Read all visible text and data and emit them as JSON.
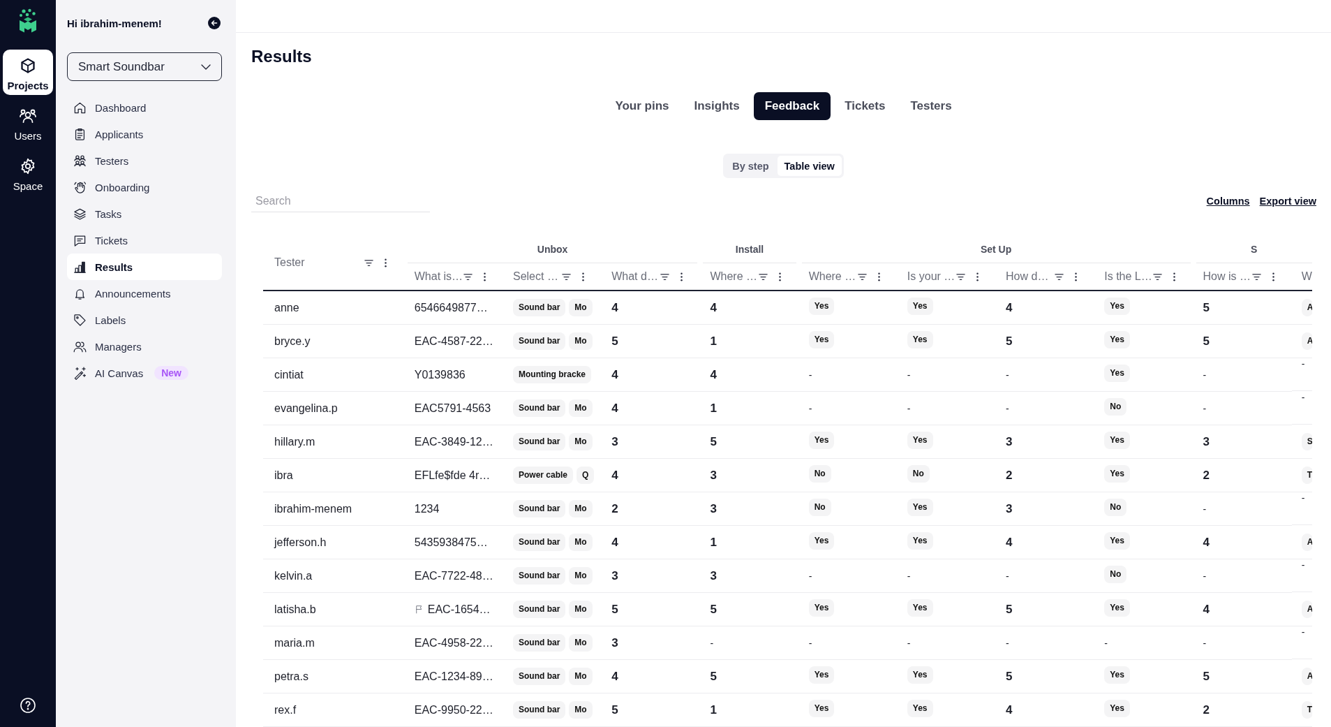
{
  "rail": {
    "items": [
      {
        "label": "Projects",
        "selected": true
      },
      {
        "label": "Users",
        "selected": false
      },
      {
        "label": "Space",
        "selected": false
      }
    ]
  },
  "sidebar": {
    "greeting": "Hi ibrahim-menem!",
    "project": "Smart Soundbar",
    "items": [
      {
        "label": "Dashboard",
        "selected": false
      },
      {
        "label": "Applicants",
        "selected": false
      },
      {
        "label": "Testers",
        "selected": false
      },
      {
        "label": "Onboarding",
        "selected": false
      },
      {
        "label": "Tasks",
        "selected": false
      },
      {
        "label": "Tickets",
        "selected": false
      },
      {
        "label": "Results",
        "selected": true
      },
      {
        "label": "Announcements",
        "selected": false
      },
      {
        "label": "Labels",
        "selected": false
      },
      {
        "label": "Managers",
        "selected": false
      },
      {
        "label": "AI Canvas",
        "selected": false,
        "badge": "New"
      }
    ]
  },
  "page": {
    "title": "Results"
  },
  "tabs": [
    {
      "label": "Your pins",
      "selected": false
    },
    {
      "label": "Insights",
      "selected": false
    },
    {
      "label": "Feedback",
      "selected": true
    },
    {
      "label": "Tickets",
      "selected": false
    },
    {
      "label": "Testers",
      "selected": false
    }
  ],
  "view_toggle": [
    {
      "label": "By step",
      "selected": false
    },
    {
      "label": "Table view",
      "selected": true
    }
  ],
  "search": {
    "placeholder": "Search"
  },
  "actions": [
    "Columns",
    "Export view"
  ],
  "table": {
    "tester_header": "Tester",
    "groups": [
      {
        "label": "Unbox",
        "columns": [
          "What is…",
          "Select …",
          "What d…"
        ]
      },
      {
        "label": "Install",
        "columns": [
          "Where …"
        ]
      },
      {
        "label": "Set Up",
        "columns": [
          "Where …",
          "Is your …",
          "How d…",
          "Is the L…"
        ]
      },
      {
        "label": "S",
        "columns": [
          "How is …",
          "W"
        ]
      }
    ],
    "rows": [
      {
        "tester": "anne",
        "flagged": false,
        "cells": [
          {
            "kind": "text",
            "text": "6546649877…"
          },
          {
            "kind": "tags",
            "tags": [
              "Sound bar",
              "Mo"
            ]
          },
          {
            "kind": "score",
            "text": "4"
          },
          {
            "kind": "score",
            "text": "4"
          },
          {
            "kind": "tag",
            "text": "Yes"
          },
          {
            "kind": "tag",
            "text": "Yes"
          },
          {
            "kind": "score",
            "text": "4"
          },
          {
            "kind": "tag",
            "text": "Yes"
          },
          {
            "kind": "score",
            "text": "5"
          },
          {
            "kind": "tag",
            "text": "A"
          }
        ]
      },
      {
        "tester": "bryce.y",
        "flagged": false,
        "cells": [
          {
            "kind": "text",
            "text": "EAC-4587-22…"
          },
          {
            "kind": "tags",
            "tags": [
              "Sound bar",
              "Mo"
            ]
          },
          {
            "kind": "score",
            "text": "5"
          },
          {
            "kind": "score",
            "text": "1"
          },
          {
            "kind": "tag",
            "text": "Yes"
          },
          {
            "kind": "tag",
            "text": "Yes"
          },
          {
            "kind": "score",
            "text": "5"
          },
          {
            "kind": "tag",
            "text": "Yes"
          },
          {
            "kind": "score",
            "text": "5"
          },
          {
            "kind": "tag",
            "text": "A"
          }
        ]
      },
      {
        "tester": "cintiat",
        "flagged": false,
        "cells": [
          {
            "kind": "text",
            "text": "Y0139836"
          },
          {
            "kind": "tags",
            "tags": [
              "Mounting bracke"
            ]
          },
          {
            "kind": "score",
            "text": "4"
          },
          {
            "kind": "score",
            "text": "4"
          },
          {
            "kind": "text",
            "text": "-"
          },
          {
            "kind": "text",
            "text": "-"
          },
          {
            "kind": "text",
            "text": "-"
          },
          {
            "kind": "tag",
            "text": "Yes"
          },
          {
            "kind": "text",
            "text": "-"
          },
          {
            "kind": "text",
            "text": "-"
          }
        ]
      },
      {
        "tester": "evangelina.p",
        "flagged": false,
        "cells": [
          {
            "kind": "text",
            "text": "EAC5791-4563"
          },
          {
            "kind": "tags",
            "tags": [
              "Sound bar",
              "Mo"
            ]
          },
          {
            "kind": "score",
            "text": "4"
          },
          {
            "kind": "score",
            "text": "1"
          },
          {
            "kind": "text",
            "text": "-"
          },
          {
            "kind": "text",
            "text": "-"
          },
          {
            "kind": "text",
            "text": "-"
          },
          {
            "kind": "tag",
            "text": "No"
          },
          {
            "kind": "text",
            "text": "-"
          },
          {
            "kind": "text",
            "text": "-"
          }
        ]
      },
      {
        "tester": "hillary.m",
        "flagged": false,
        "cells": [
          {
            "kind": "text",
            "text": "EAC-3849-12…"
          },
          {
            "kind": "tags",
            "tags": [
              "Sound bar",
              "Mo"
            ]
          },
          {
            "kind": "score",
            "text": "3"
          },
          {
            "kind": "score",
            "text": "5"
          },
          {
            "kind": "tag",
            "text": "Yes"
          },
          {
            "kind": "tag",
            "text": "Yes"
          },
          {
            "kind": "score",
            "text": "3"
          },
          {
            "kind": "tag",
            "text": "Yes"
          },
          {
            "kind": "score",
            "text": "3"
          },
          {
            "kind": "tag",
            "text": "S"
          }
        ]
      },
      {
        "tester": "ibra",
        "flagged": false,
        "cells": [
          {
            "kind": "text",
            "text": "EFLfe$fde 4r…"
          },
          {
            "kind": "tags",
            "tags": [
              "Power cable",
              "Q"
            ]
          },
          {
            "kind": "score",
            "text": "4"
          },
          {
            "kind": "score",
            "text": "3"
          },
          {
            "kind": "tag",
            "text": "No"
          },
          {
            "kind": "tag",
            "text": "No"
          },
          {
            "kind": "score",
            "text": "2"
          },
          {
            "kind": "tag",
            "text": "Yes"
          },
          {
            "kind": "score",
            "text": "2"
          },
          {
            "kind": "tag",
            "text": "T"
          }
        ]
      },
      {
        "tester": "ibrahim-menem",
        "flagged": false,
        "cells": [
          {
            "kind": "text",
            "text": "1234"
          },
          {
            "kind": "tags",
            "tags": [
              "Sound bar",
              "Mo"
            ]
          },
          {
            "kind": "score",
            "text": "2"
          },
          {
            "kind": "score",
            "text": "3"
          },
          {
            "kind": "tag",
            "text": "No"
          },
          {
            "kind": "tag",
            "text": "Yes"
          },
          {
            "kind": "score",
            "text": "3"
          },
          {
            "kind": "tag",
            "text": "No"
          },
          {
            "kind": "text",
            "text": "-"
          },
          {
            "kind": "text",
            "text": "-"
          }
        ]
      },
      {
        "tester": "jefferson.h",
        "flagged": false,
        "cells": [
          {
            "kind": "text",
            "text": "5435938475…"
          },
          {
            "kind": "tags",
            "tags": [
              "Sound bar",
              "Mo"
            ]
          },
          {
            "kind": "score",
            "text": "4"
          },
          {
            "kind": "score",
            "text": "1"
          },
          {
            "kind": "tag",
            "text": "Yes"
          },
          {
            "kind": "tag",
            "text": "Yes"
          },
          {
            "kind": "score",
            "text": "4"
          },
          {
            "kind": "tag",
            "text": "Yes"
          },
          {
            "kind": "score",
            "text": "4"
          },
          {
            "kind": "tag",
            "text": "A"
          }
        ]
      },
      {
        "tester": "kelvin.a",
        "flagged": false,
        "cells": [
          {
            "kind": "text",
            "text": "EAC-7722-48…"
          },
          {
            "kind": "tags",
            "tags": [
              "Sound bar",
              "Mo"
            ]
          },
          {
            "kind": "score",
            "text": "3"
          },
          {
            "kind": "score",
            "text": "3"
          },
          {
            "kind": "text",
            "text": "-"
          },
          {
            "kind": "text",
            "text": "-"
          },
          {
            "kind": "text",
            "text": "-"
          },
          {
            "kind": "tag",
            "text": "No"
          },
          {
            "kind": "text",
            "text": "-"
          },
          {
            "kind": "text",
            "text": "-"
          }
        ]
      },
      {
        "tester": "latisha.b",
        "flagged": true,
        "cells": [
          {
            "kind": "text",
            "text": "EAC-1654…"
          },
          {
            "kind": "tags",
            "tags": [
              "Sound bar",
              "Mo"
            ]
          },
          {
            "kind": "score",
            "text": "5"
          },
          {
            "kind": "score",
            "text": "5"
          },
          {
            "kind": "tag",
            "text": "Yes"
          },
          {
            "kind": "tag",
            "text": "Yes"
          },
          {
            "kind": "score",
            "text": "5"
          },
          {
            "kind": "tag",
            "text": "Yes"
          },
          {
            "kind": "score",
            "text": "4"
          },
          {
            "kind": "tag",
            "text": "A"
          }
        ]
      },
      {
        "tester": "maria.m",
        "flagged": false,
        "cells": [
          {
            "kind": "text",
            "text": "EAC-4958-22…"
          },
          {
            "kind": "tags",
            "tags": [
              "Sound bar",
              "Mo"
            ]
          },
          {
            "kind": "score",
            "text": "3"
          },
          {
            "kind": "text",
            "text": "-"
          },
          {
            "kind": "text",
            "text": "-"
          },
          {
            "kind": "text",
            "text": "-"
          },
          {
            "kind": "text",
            "text": "-"
          },
          {
            "kind": "text",
            "text": "-"
          },
          {
            "kind": "text",
            "text": "-"
          },
          {
            "kind": "text",
            "text": "-"
          }
        ]
      },
      {
        "tester": "petra.s",
        "flagged": false,
        "cells": [
          {
            "kind": "text",
            "text": "EAC-1234-89…"
          },
          {
            "kind": "tags",
            "tags": [
              "Sound bar",
              "Mo"
            ]
          },
          {
            "kind": "score",
            "text": "4"
          },
          {
            "kind": "score",
            "text": "5"
          },
          {
            "kind": "tag",
            "text": "Yes"
          },
          {
            "kind": "tag",
            "text": "Yes"
          },
          {
            "kind": "score",
            "text": "5"
          },
          {
            "kind": "tag",
            "text": "Yes"
          },
          {
            "kind": "score",
            "text": "5"
          },
          {
            "kind": "tag",
            "text": "A"
          }
        ]
      },
      {
        "tester": "rex.f",
        "flagged": false,
        "cells": [
          {
            "kind": "text",
            "text": "EAC-9950-22…"
          },
          {
            "kind": "tags",
            "tags": [
              "Sound bar",
              "Mo"
            ]
          },
          {
            "kind": "score",
            "text": "5"
          },
          {
            "kind": "score",
            "text": "1"
          },
          {
            "kind": "tag",
            "text": "Yes"
          },
          {
            "kind": "tag",
            "text": "Yes"
          },
          {
            "kind": "score",
            "text": "4"
          },
          {
            "kind": "tag",
            "text": "Yes"
          },
          {
            "kind": "score",
            "text": "2"
          },
          {
            "kind": "tag",
            "text": "T"
          }
        ]
      }
    ]
  }
}
